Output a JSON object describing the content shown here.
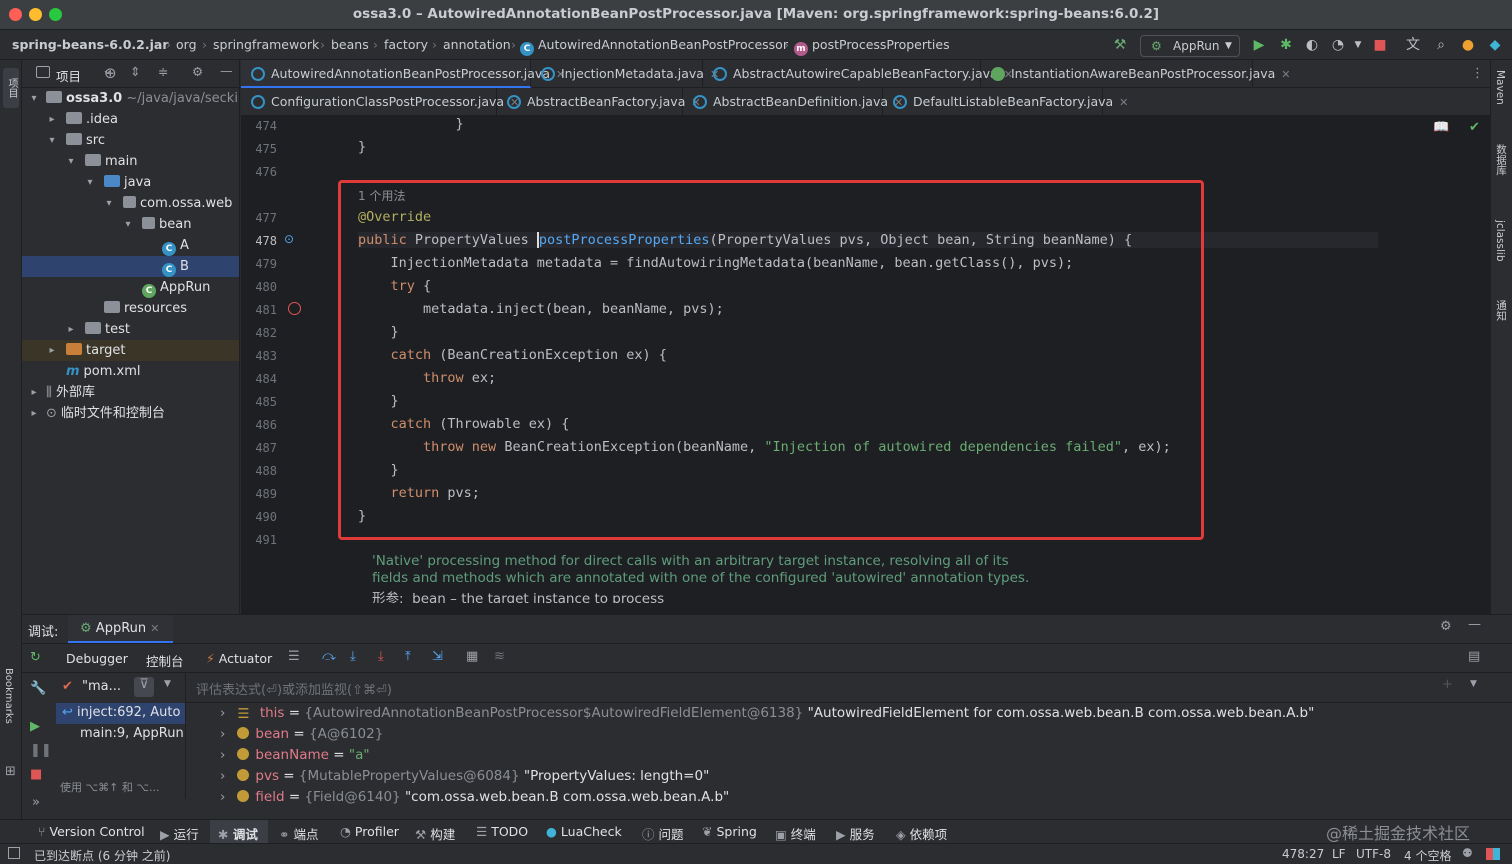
{
  "title": "ossa3.0 – AutowiredAnnotationBeanPostProcessor.java [Maven: org.springframework:spring-beans:6.0.2]",
  "breadcrumb": [
    "spring-beans-6.0.2.jar",
    "org",
    "springframework",
    "beans",
    "factory",
    "annotation",
    "AutowiredAnnotationBeanPostProcessor",
    "postProcessProperties"
  ],
  "run_config": "AppRun",
  "project": {
    "header": "项目",
    "items": [
      {
        "label": "ossa3.0",
        "extra": "~/java/java/seckil",
        "type": "folder"
      },
      {
        "label": ".idea",
        "type": "folder"
      },
      {
        "label": "src",
        "type": "folder"
      },
      {
        "label": "main",
        "type": "folder"
      },
      {
        "label": "java",
        "type": "folder"
      },
      {
        "label": "com.ossa.web",
        "type": "package"
      },
      {
        "label": "bean",
        "type": "package"
      },
      {
        "label": "A",
        "type": "class"
      },
      {
        "label": "B",
        "type": "class"
      },
      {
        "label": "AppRun",
        "type": "class"
      },
      {
        "label": "resources",
        "type": "folder"
      },
      {
        "label": "test",
        "type": "folder"
      },
      {
        "label": "target",
        "type": "folder"
      },
      {
        "label": "pom.xml",
        "type": "file"
      },
      {
        "label": "外部库",
        "type": "lib"
      },
      {
        "label": "临时文件和控制台",
        "type": "lib"
      }
    ]
  },
  "tabs_row1": [
    "AutowiredAnnotationBeanPostProcessor.java",
    "InjectionMetadata.java",
    "AbstractAutowireCapableBeanFactory.java",
    "InstantiationAwareBeanPostProcessor.java"
  ],
  "tabs_row2": [
    "ConfigurationClassPostProcessor.java",
    "AbstractBeanFactory.java",
    "AbstractBeanDefinition.java",
    "DefaultListableBeanFactory.java"
  ],
  "usage_hint": "1 个用法",
  "line_numbers": [
    "474",
    "475",
    "476",
    "477",
    "478",
    "479",
    "480",
    "481",
    "482",
    "483",
    "484",
    "485",
    "486",
    "487",
    "488",
    "489",
    "490",
    "491"
  ],
  "doc": {
    "line1": "'Native' processing method for direct calls with an arbitrary target instance, resolving all of its",
    "line2": "fields and methods which are annotated with one of the configured 'autowired' annotation types.",
    "param_label": "形参:",
    "param_text": "bean – the target instance to process"
  },
  "right_tools": [
    "Maven",
    "数据库",
    "jclasslib",
    "通知"
  ],
  "debug": {
    "label": "调试:",
    "session": "AppRun",
    "tabs": [
      "Debugger",
      "控制台",
      "Actuator"
    ],
    "thread": "\"ma...",
    "eval_placeholder": "评估表达式(⏎)或添加监视(⇧⌘⏎)",
    "frames": [
      "inject:692, Auto",
      "main:9, AppRun"
    ],
    "frames_hint": "使用 ⌥⌘↑ 和 ⌥...",
    "vars": [
      {
        "name": "this",
        "type": "{AutowiredAnnotationBeanPostProcessor$AutowiredFieldElement@6138}",
        "value": "\"AutowiredFieldElement for com.ossa.web.bean.B com.ossa.web.bean.A.b\""
      },
      {
        "name": "bean",
        "type": "{A@6102}",
        "value": ""
      },
      {
        "name": "beanName",
        "type": "",
        "value": "\"a\""
      },
      {
        "name": "pvs",
        "type": "{MutablePropertyValues@6084}",
        "value": "\"PropertyValues: length=0\""
      },
      {
        "name": "field",
        "type": "{Field@6140}",
        "value": "\"com.ossa.web.bean.B com.ossa.web.bean.A.b\""
      }
    ]
  },
  "bottom_tools": [
    "Version Control",
    "运行",
    "调试",
    "端点",
    "Profiler",
    "构建",
    "TODO",
    "LuaCheck",
    "问题",
    "Spring",
    "终端",
    "服务",
    "依赖项"
  ],
  "status": {
    "message": "已到达断点 (6 分钟 之前)",
    "position": "478:27",
    "line_sep": "LF",
    "encoding": "UTF-8",
    "indent": "4 个空格",
    "watermark": "@稀土掘金技术社区"
  },
  "colors": {
    "keyword": "#cf8e6d",
    "annotation": "#b3ae60",
    "string": "#6aab73",
    "method": "#56a8f5",
    "highlight_box": "#e03a3a"
  }
}
